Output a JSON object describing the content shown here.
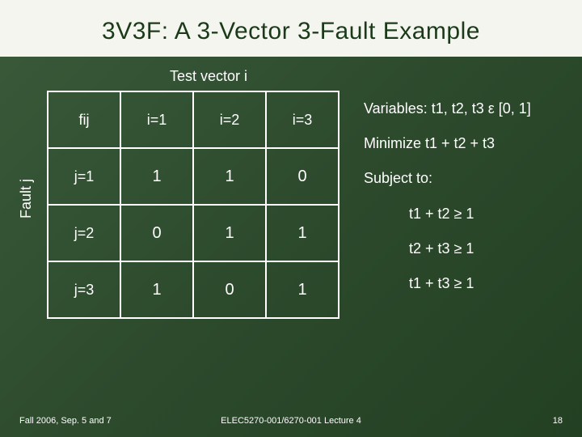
{
  "title": "3V3F: A 3-Vector 3-Fault Example",
  "tv_label": "Test vector i",
  "fj_label": "Fault j",
  "table": {
    "header": [
      "fij",
      "i=1",
      "i=2",
      "i=3"
    ],
    "rows": [
      {
        "label": "j=1",
        "cells": [
          "1",
          "1",
          "0"
        ]
      },
      {
        "label": "j=2",
        "cells": [
          "0",
          "1",
          "1"
        ]
      },
      {
        "label": "j=3",
        "cells": [
          "1",
          "0",
          "1"
        ]
      }
    ]
  },
  "side": {
    "vars": "Variables: t1, t2, t3 ε [0, 1]",
    "obj": "Minimize t1 + t2 + t3",
    "subj": "Subject to:",
    "c1": "t1 + t2 ≥ 1",
    "c2": "t2 + t3 ≥ 1",
    "c3": "t1 + t3 ≥ 1"
  },
  "footer": {
    "left": "Fall 2006, Sep. 5 and 7",
    "center": "ELEC5270-001/6270-001 Lecture 4",
    "right": "18"
  },
  "chart_data": {
    "type": "table",
    "title": "fij matrix (fault j vs test vector i)",
    "columns": [
      "i=1",
      "i=2",
      "i=3"
    ],
    "rows": [
      "j=1",
      "j=2",
      "j=3"
    ],
    "values": [
      [
        1,
        1,
        0
      ],
      [
        0,
        1,
        1
      ],
      [
        1,
        0,
        1
      ]
    ]
  }
}
